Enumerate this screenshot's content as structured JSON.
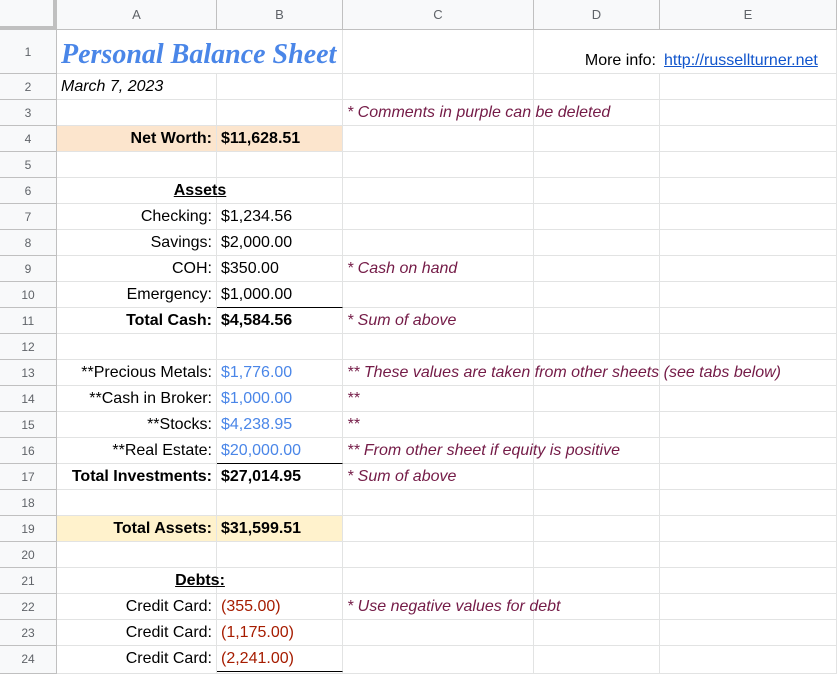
{
  "columns": [
    "A",
    "B",
    "C",
    "D",
    "E"
  ],
  "rows": [
    "1",
    "2",
    "3",
    "4",
    "5",
    "6",
    "7",
    "8",
    "9",
    "10",
    "11",
    "12",
    "13",
    "14",
    "15",
    "16",
    "17",
    "18",
    "19",
    "20",
    "21",
    "22",
    "23",
    "24"
  ],
  "title": "Personal Balance Sheet",
  "date": "March 7, 2023",
  "more_info_label": "More info:",
  "more_info_link": "http://russellturner.net",
  "comment_deletable": "* Comments in purple can be deleted",
  "net_worth": {
    "label": "Net Worth:",
    "value": "$11,628.51"
  },
  "assets_header": "Assets",
  "assets": [
    {
      "label": "Checking:",
      "value": "$1,234.56"
    },
    {
      "label": "Savings:",
      "value": "$2,000.00"
    },
    {
      "label": "COH:",
      "value": "$350.00",
      "note": "* Cash on hand"
    },
    {
      "label": "Emergency:",
      "value": "$1,000.00"
    }
  ],
  "total_cash": {
    "label": "Total Cash:",
    "value": "$4,584.56",
    "note": "* Sum of above"
  },
  "investments": [
    {
      "label": "**Precious Metals:",
      "value": "$1,776.00",
      "note": "** These values are taken from other sheets (see tabs below)"
    },
    {
      "label": "**Cash in Broker:",
      "value": "$1,000.00",
      "note": "**"
    },
    {
      "label": "**Stocks:",
      "value": "$4,238.95",
      "note": "**"
    },
    {
      "label": "**Real Estate:",
      "value": "$20,000.00",
      "note": "** From other sheet if equity is positive"
    }
  ],
  "total_investments": {
    "label": "Total Investments:",
    "value": "$27,014.95",
    "note": "* Sum of above"
  },
  "total_assets": {
    "label": "Total Assets:",
    "value": "$31,599.51"
  },
  "debts_header": "Debts:",
  "debts": [
    {
      "label": "Credit Card:",
      "value": "(355.00)",
      "note": "* Use negative values for debt"
    },
    {
      "label": "Credit Card:",
      "value": "(1,175.00)"
    },
    {
      "label": "Credit Card:",
      "value": "(2,241.00)"
    }
  ],
  "colors": {
    "title": "#4a86e8",
    "linked_value": "#4a86e8",
    "comment": "#741b47",
    "negative": "#a61c00",
    "net_worth_bg": "#fce5cd",
    "total_assets_bg": "#fff2cc"
  }
}
